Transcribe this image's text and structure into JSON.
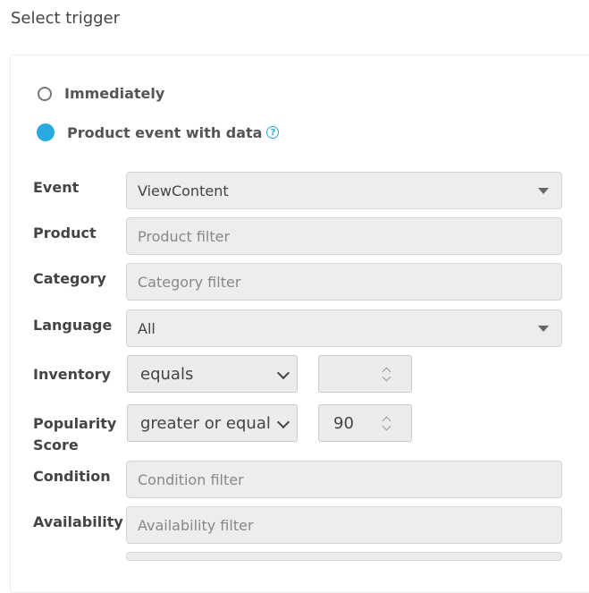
{
  "header": {
    "title": "Select trigger"
  },
  "trigger_options": [
    {
      "label": "Immediately",
      "selected": false
    },
    {
      "label": "Product event with data",
      "selected": true
    }
  ],
  "help_icon_glyph": "?",
  "colors": {
    "accent": "#29a9e0",
    "field_bg": "#ededed"
  },
  "fields": {
    "event": {
      "label": "Event",
      "value": "ViewContent"
    },
    "product": {
      "label": "Product",
      "placeholder": "Product filter"
    },
    "category": {
      "label": "Category",
      "placeholder": "Category filter"
    },
    "language": {
      "label": "Language",
      "value": "All"
    },
    "inventory": {
      "label": "Inventory",
      "operator": "equals",
      "value": ""
    },
    "popularity": {
      "label_line1": "Popularity",
      "label_line2": "Score",
      "operator": "greater or equal",
      "value": "90"
    },
    "condition": {
      "label": "Condition",
      "placeholder": "Condition filter"
    },
    "availability": {
      "label": "Availability",
      "placeholder": "Availability filter"
    }
  }
}
